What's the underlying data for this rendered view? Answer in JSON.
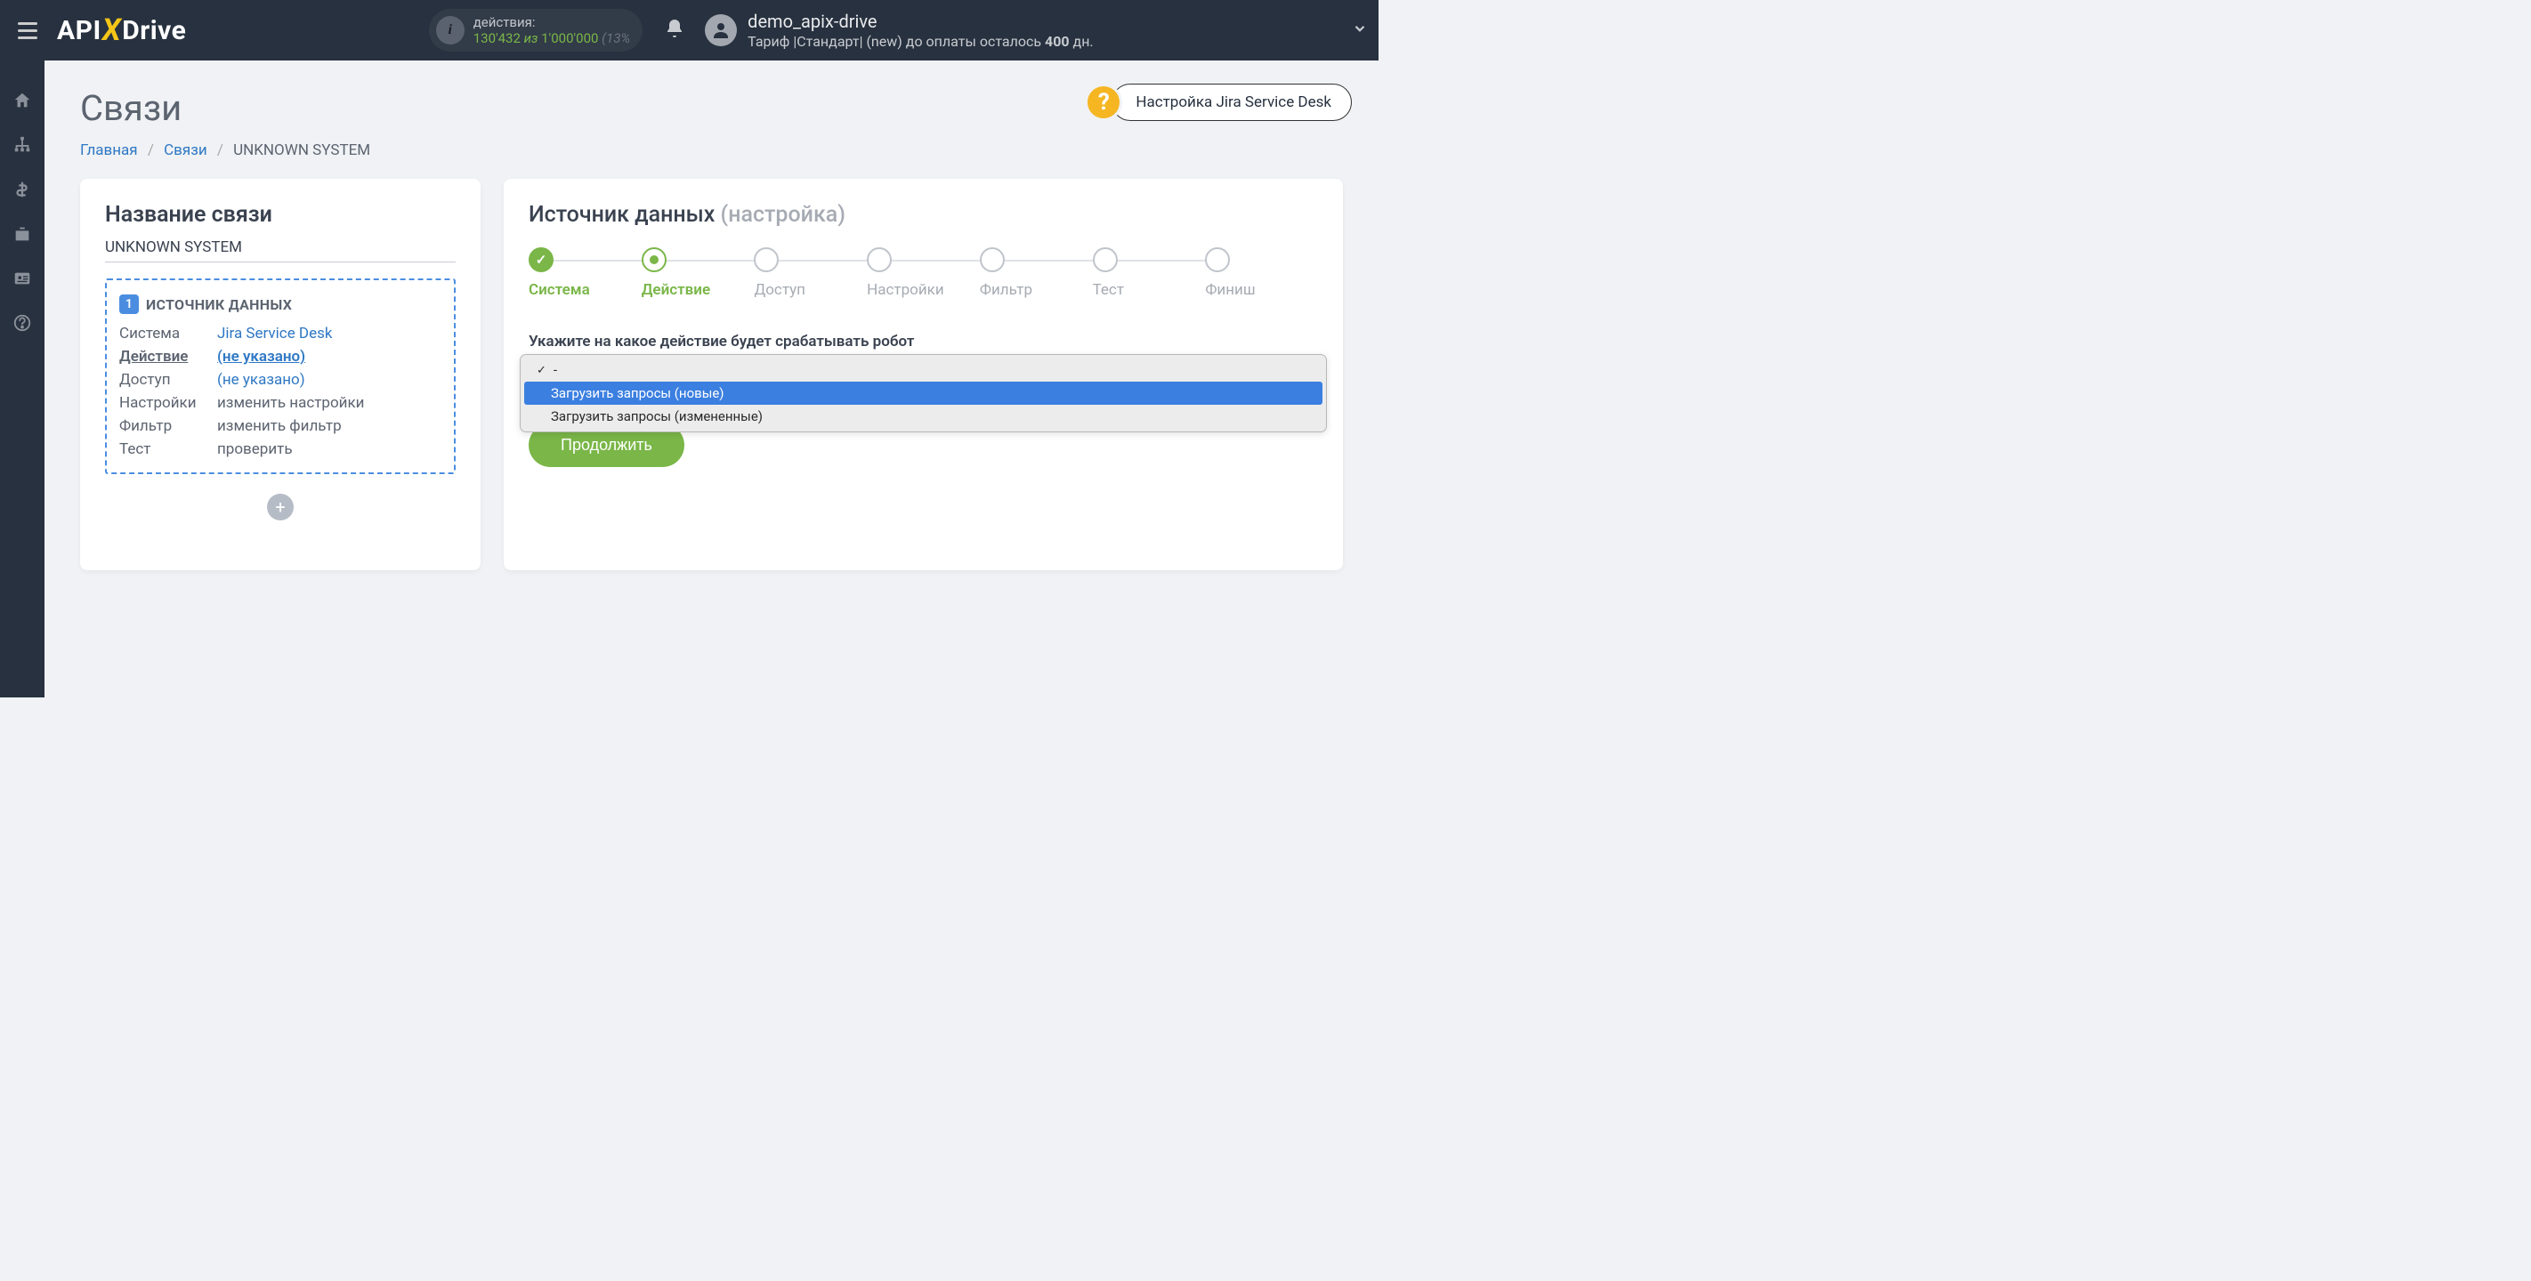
{
  "topbar": {
    "actions_label": "действия:",
    "actions_count": "130'432",
    "actions_of": "из",
    "actions_total": "1'000'000",
    "actions_extra": "(13%",
    "user_name": "demo_apix-drive",
    "tariff_prefix": "Тариф |Стандарт| (new) до оплаты осталось ",
    "tariff_days": "400",
    "tariff_suffix": " дн."
  },
  "page": {
    "title": "Связи",
    "breadcrumb_home": "Главная",
    "breadcrumb_links": "Связи",
    "breadcrumb_current": "UNKNOWN SYSTEM",
    "help_label": "Настройка Jira Service Desk"
  },
  "left": {
    "title": "Название связи",
    "conn_name": "UNKNOWN SYSTEM",
    "badge_num": "1",
    "source_header": "ИСТОЧНИК ДАННЫХ",
    "rows": {
      "system_k": "Система",
      "system_v": "Jira Service Desk",
      "action_k": "Действие",
      "action_v": "(не указано)",
      "access_k": "Доступ",
      "access_v": "(не указано)",
      "settings_k": "Настройки",
      "settings_v": "изменить настройки",
      "filter_k": "Фильтр",
      "filter_v": "изменить фильтр",
      "test_k": "Тест",
      "test_v": "проверить"
    }
  },
  "right": {
    "title": "Источник данных ",
    "title_muted": "(настройка)",
    "steps": [
      "Система",
      "Действие",
      "Доступ",
      "Настройки",
      "Фильтр",
      "Тест",
      "Финиш"
    ],
    "prompt": "Укажите на какое действие будет срабатывать робот",
    "options": [
      "-",
      "Загрузить запросы (новые)",
      "Загрузить запросы (измененные)"
    ],
    "continue": "Продолжить"
  }
}
